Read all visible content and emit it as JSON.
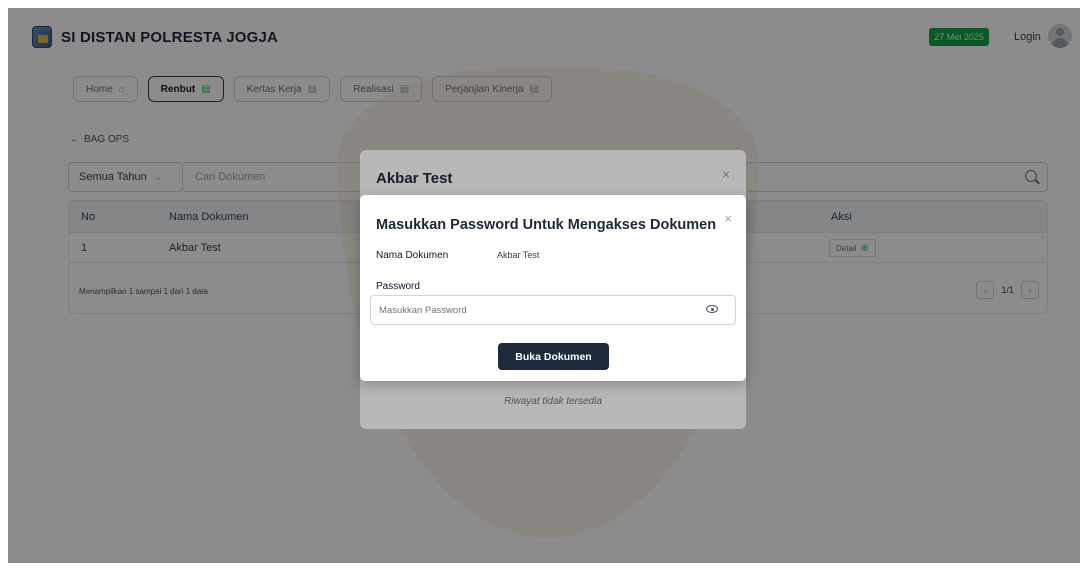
{
  "header": {
    "app_title": "SI DISTAN POLRESTA JOGJA",
    "date_badge": "27 Mei 2025",
    "login_label": "Login"
  },
  "nav": {
    "tabs": [
      {
        "label": "Home",
        "icon": "home-icon"
      },
      {
        "label": "Renbut",
        "icon": "document-icon",
        "active": true
      },
      {
        "label": "Kertas Kerja",
        "icon": "document-icon"
      },
      {
        "label": "Realisasi",
        "icon": "document-icon"
      },
      {
        "label": "Perjanjian Kinerja",
        "icon": "document-icon"
      }
    ]
  },
  "breadcrumb": {
    "back_label": "BAG OPS"
  },
  "filter": {
    "year_select": "Semua Tahun",
    "search_placeholder": "Cari Dokumen"
  },
  "table": {
    "headers": [
      "No",
      "Nama Dokumen",
      "Aksi"
    ],
    "rows": [
      {
        "no": "1",
        "nama": "Akbar Test",
        "aksi": "Detail"
      }
    ],
    "footer": "Menampilkan 1 sampai 1 dari 1 data",
    "pager": "1/1"
  },
  "modal_history": {
    "title": "Akbar Test",
    "empty_text": "Riwayat tidak tersedia"
  },
  "modal_password": {
    "title": "Masukkan Password Untuk Mengakses Dokumen",
    "doc_label": "Nama Dokumen",
    "doc_value": "Akbar Test",
    "password_label": "Password",
    "password_placeholder": "Masukkan Password",
    "submit_label": "Buka Dokumen"
  },
  "colors": {
    "accent_green": "#16a34a",
    "button_dark": "#1e293b",
    "overlay": "rgba(0,0,0,0.45)"
  }
}
